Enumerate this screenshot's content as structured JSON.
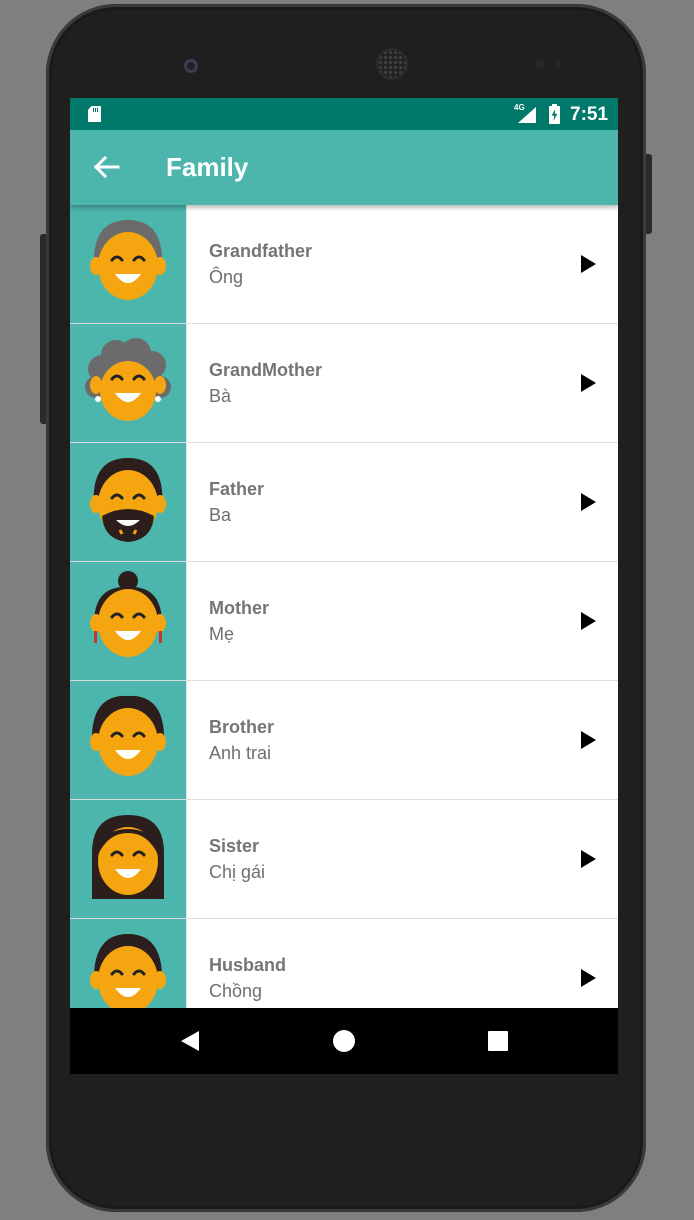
{
  "status_bar": {
    "time": "7:51",
    "network": "4G",
    "icons": [
      "sd-card-icon",
      "signal-icon",
      "battery-charging-icon"
    ]
  },
  "app_bar": {
    "title": "Family",
    "back_icon": "arrow-back-icon",
    "background": "#4db6ac",
    "status_color": "#00796b"
  },
  "items": [
    {
      "english": "Grandfather",
      "vietnamese": "Ông",
      "avatar": "grandfather-avatar"
    },
    {
      "english": "GrandMother",
      "vietnamese": "Bà",
      "avatar": "grandmother-avatar"
    },
    {
      "english": "Father",
      "vietnamese": "Ba",
      "avatar": "father-avatar"
    },
    {
      "english": "Mother",
      "vietnamese": "Mẹ",
      "avatar": "mother-avatar"
    },
    {
      "english": "Brother",
      "vietnamese": "Anh trai",
      "avatar": "brother-avatar"
    },
    {
      "english": "Sister",
      "vietnamese": "Chị gái",
      "avatar": "sister-avatar"
    },
    {
      "english": "Husband",
      "vietnamese": "Chồng",
      "avatar": "husband-avatar"
    }
  ],
  "nav_bar": {
    "icons": [
      "back-triangle-icon",
      "home-circle-icon",
      "recents-square-icon"
    ]
  },
  "colors": {
    "skin": "#f5a50f",
    "hair_dark": "#2d1e1e",
    "hair_gray": "#6b6b6b"
  }
}
